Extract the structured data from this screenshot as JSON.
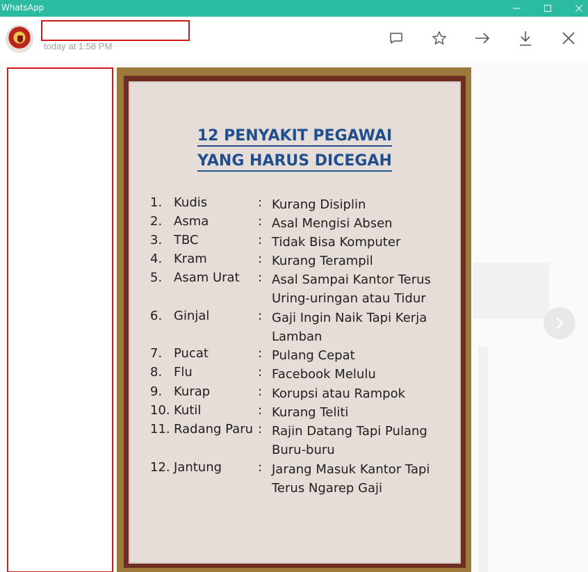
{
  "window": {
    "title": "WhatsApp",
    "controls": [
      "minimize-icon",
      "maximize-icon",
      "close-icon"
    ]
  },
  "header": {
    "sender_name": "",
    "timestamp": "today at 1:58 PM",
    "icons": [
      "reply-icon",
      "star-icon",
      "forward-icon",
      "download-icon",
      "close-icon"
    ]
  },
  "poster": {
    "title_line1": "12 PENYAKIT PEGAWAI",
    "title_line2": "YANG HARUS DICEGAH",
    "items": [
      {
        "num": "1.",
        "disease": "Kudis",
        "colon": ":",
        "meaning": "Kurang Disiplin"
      },
      {
        "num": "2.",
        "disease": "Asma",
        "colon": ":",
        "meaning": "Asal Mengisi Absen"
      },
      {
        "num": "3.",
        "disease": "TBC",
        "colon": ":",
        "meaning": "Tidak Bisa Komputer"
      },
      {
        "num": "4.",
        "disease": "Kram",
        "colon": ":",
        "meaning": "Kurang Terampil"
      },
      {
        "num": "5.",
        "disease": "Asam Urat",
        "colon": ":",
        "meaning": "Asal Sampai Kantor Terus Uring-uringan atau Tidur"
      },
      {
        "num": "6.",
        "disease": "Ginjal",
        "colon": ":",
        "meaning": "Gaji Ingin Naik Tapi Kerja Lamban"
      },
      {
        "num": "7.",
        "disease": "Pucat",
        "colon": ":",
        "meaning": "Pulang Cepat"
      },
      {
        "num": "8.",
        "disease": "Flu",
        "colon": ":",
        "meaning": "Facebook Melulu"
      },
      {
        "num": "9.",
        "disease": "Kurap",
        "colon": ":",
        "meaning": "Korupsi atau Rampok"
      },
      {
        "num": "10.",
        "disease": "Kutil",
        "colon": ":",
        "meaning": "Kurang Teliti"
      },
      {
        "num": "11.",
        "disease": "Radang Paru",
        "colon": ":",
        "meaning": "Rajin Datang Tapi Pulang Buru-buru"
      },
      {
        "num": "12.",
        "disease": "Jantung",
        "colon": ":",
        "meaning": "Jarang Masuk Kantor Tapi Terus Ngarep Gaji"
      }
    ]
  },
  "colors": {
    "titlebar": "#2bbba0",
    "redaction": "#d0191b",
    "poster_title": "#1f4f8f"
  }
}
